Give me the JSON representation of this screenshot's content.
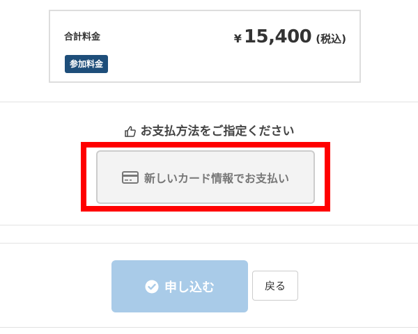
{
  "summary": {
    "total_label": "合計料金",
    "fee_badge": "参加料金",
    "currency_symbol": "¥",
    "amount": "15,400",
    "tax_note": "(税込)"
  },
  "payment": {
    "heading": "お支払方法をご指定ください",
    "heading_icon": "hand-pointing-icon",
    "new_card_label": "新しいカード情報でお支払い",
    "new_card_icon": "credit-card-icon"
  },
  "actions": {
    "submit_label": "申し込む",
    "submit_icon": "check-circle-icon",
    "back_label": "戻る"
  },
  "colors": {
    "badge_bg": "#1e4e7a",
    "highlight": "#ff0000",
    "submit_bg": "#a9cbe8"
  }
}
